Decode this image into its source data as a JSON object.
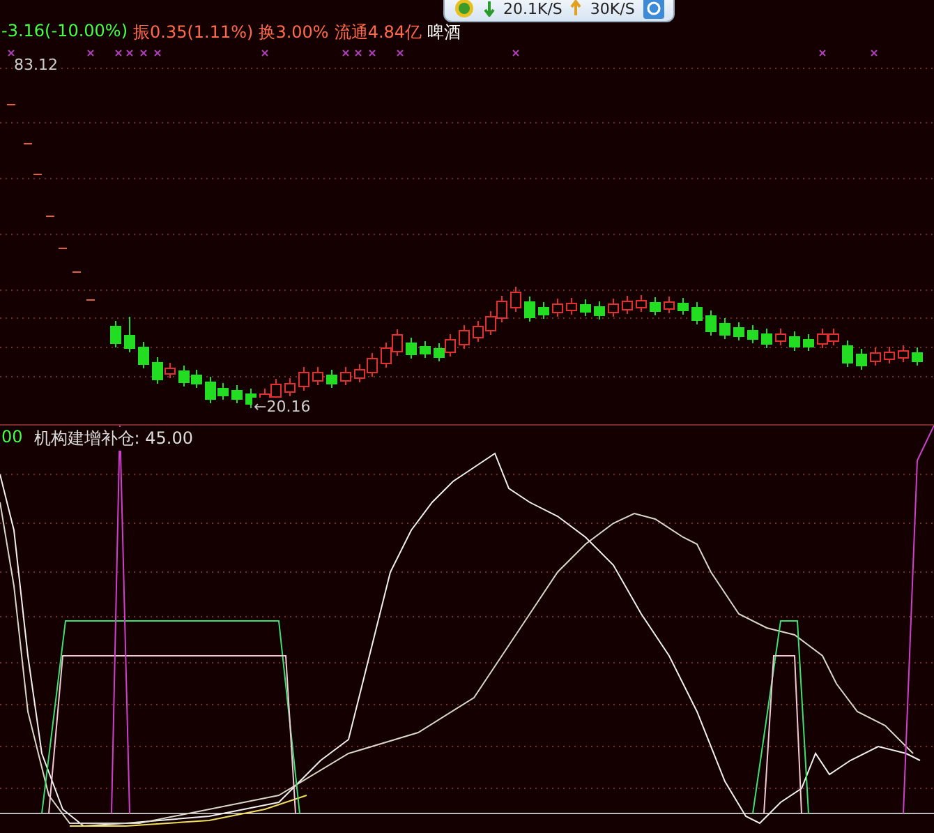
{
  "net_widget": {
    "download": "20.1K/S",
    "upload": "30K/S"
  },
  "quote": [
    {
      "text": "-3.16(-10.00%)",
      "color": "#44ff44"
    },
    {
      "text": "振0.35(1.11%)",
      "color": "#ff6a4a"
    },
    {
      "text": "换3.00%",
      "color": "#ff6a4a"
    },
    {
      "text": "流通4.84亿",
      "color": "#ff6a4a"
    },
    {
      "text": "啤酒",
      "color": "#ffffff"
    }
  ],
  "price_chart": {
    "high_label": "83.12",
    "low_label": "←20.16"
  },
  "indicator": {
    "value_prefix": "00",
    "label": "机构建增补仓: 45.00"
  }
}
